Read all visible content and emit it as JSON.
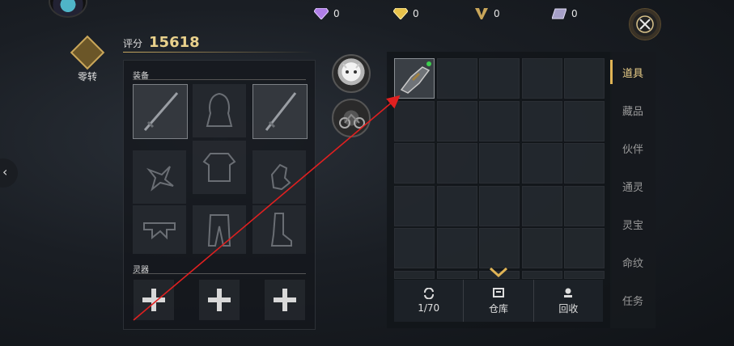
{
  "currencies": [
    {
      "name": "purple-diamond",
      "value": "0",
      "color": "#b07ee8"
    },
    {
      "name": "gold-diamond",
      "value": "0",
      "color": "#e8c24a"
    },
    {
      "name": "v-coin",
      "value": "0",
      "color": "#c9a65a"
    },
    {
      "name": "ticket",
      "value": "0",
      "color": "#a6a0c8"
    }
  ],
  "zero_turn": {
    "label": "零转"
  },
  "score": {
    "label": "评分",
    "value": "15618"
  },
  "equipment": {
    "section_title": "装备",
    "slots": [
      {
        "icon": "sword-icon",
        "selected": true
      },
      {
        "icon": "hooded-cloak-icon",
        "selected": false
      },
      {
        "icon": "sword-icon",
        "selected": true
      },
      {
        "icon": "shuriken-icon",
        "selected": false
      },
      {
        "icon": "armor-icon",
        "selected": false
      },
      {
        "icon": "glove-icon",
        "selected": false
      },
      {
        "icon": "belt-icon",
        "selected": false
      },
      {
        "icon": "pants-icon",
        "selected": false
      },
      {
        "icon": "boot-icon",
        "selected": false
      }
    ]
  },
  "spirit": {
    "section_title": "灵器"
  },
  "pets": [
    {
      "icon": "white-cat-icon"
    },
    {
      "icon": "motorcycle-icon"
    }
  ],
  "inventory": {
    "item_icon": "gauntlet-icon",
    "capacity_label": "1/70",
    "warehouse_label": "仓库",
    "recycle_label": "回收"
  },
  "tabs": [
    {
      "label": "道具",
      "active": true
    },
    {
      "label": "藏品",
      "active": false
    },
    {
      "label": "伙伴",
      "active": false
    },
    {
      "label": "通灵",
      "active": false
    },
    {
      "label": "灵宝",
      "active": false
    },
    {
      "label": "命纹",
      "active": false
    },
    {
      "label": "任务",
      "active": false
    }
  ],
  "annotation": {
    "color": "#e02020"
  }
}
